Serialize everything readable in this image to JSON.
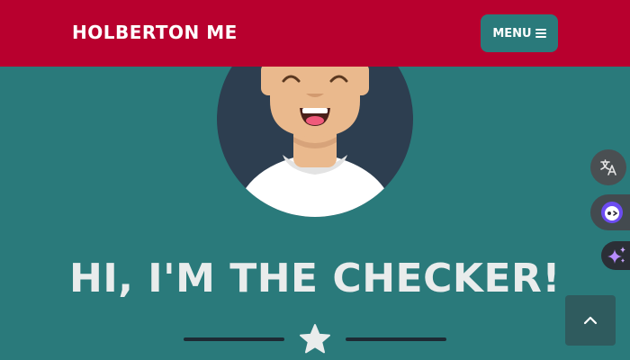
{
  "header": {
    "brand": "HOLBERTON ME",
    "menu_label": "MENU",
    "menu_icon": "hamburger-icon",
    "background": "#b8002e"
  },
  "hero": {
    "avatar_icon": "smiling-character-avatar",
    "headline": "HI, I'M THE CHECKER!",
    "divider_icon": "star-icon",
    "background": "#2a7a7b"
  },
  "floating_actions": [
    {
      "name": "translate-icon"
    },
    {
      "name": "assistant-face-icon"
    },
    {
      "name": "sparkle-icon"
    }
  ],
  "scroll_top": {
    "icon": "chevron-up-icon"
  }
}
